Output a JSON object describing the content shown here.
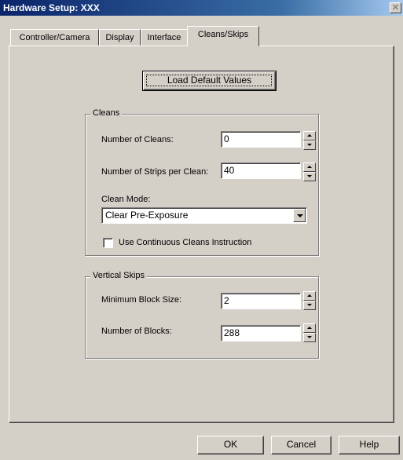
{
  "window": {
    "title": "Hardware Setup:  XXX",
    "close_label": "✕"
  },
  "tabs": [
    {
      "label": "Controller/Camera",
      "active": false
    },
    {
      "label": "Display",
      "active": false
    },
    {
      "label": "Interface",
      "active": false
    },
    {
      "label": "Cleans/Skips",
      "active": true
    }
  ],
  "load_defaults_label": "Load Default Values",
  "cleans": {
    "legend": "Cleans",
    "number_of_cleans_label": "Number of Cleans:",
    "number_of_cleans_value": "0",
    "strips_per_clean_label": "Number of Strips per Clean:",
    "strips_per_clean_value": "40",
    "clean_mode_label": "Clean Mode:",
    "clean_mode_value": "Clear Pre-Exposure",
    "continuous_cleans_label": "Use Continuous Cleans Instruction",
    "continuous_cleans_checked": false
  },
  "vertical_skips": {
    "legend": "Vertical Skips",
    "min_block_size_label": "Minimum Block Size:",
    "min_block_size_value": "2",
    "number_of_blocks_label": "Number of Blocks:",
    "number_of_blocks_value": "288"
  },
  "footer": {
    "ok_label": "OK",
    "cancel_label": "Cancel",
    "help_label": "Help"
  }
}
